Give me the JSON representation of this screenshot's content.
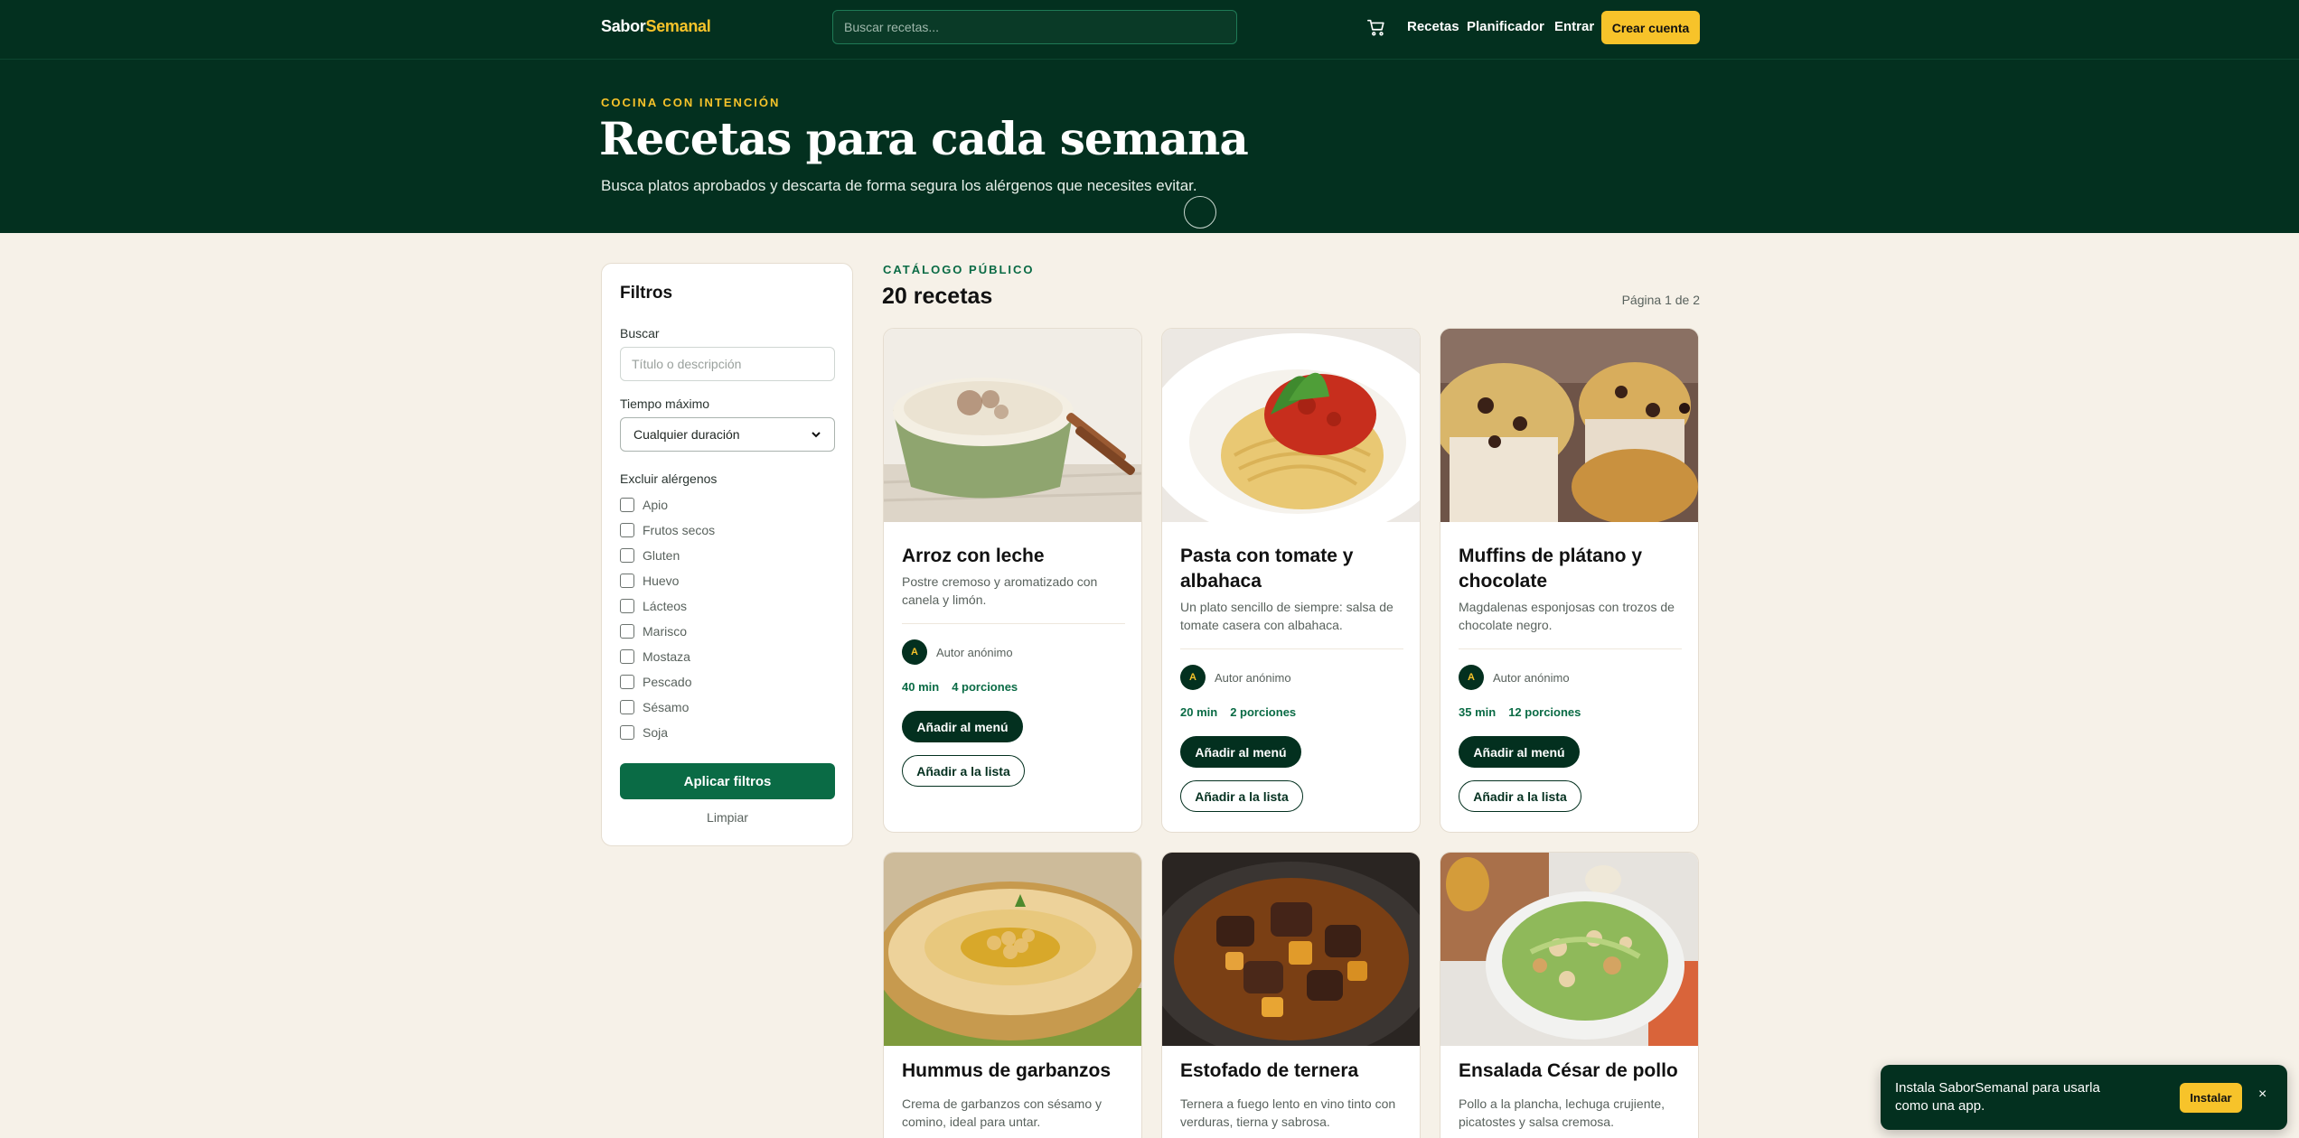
{
  "nav": {
    "logo_part1": "Sabor",
    "logo_part2": "Semanal",
    "search_placeholder": "Buscar recetas...",
    "links": [
      "Recetas",
      "Planificador",
      "Entrar"
    ],
    "create_account": "Crear cuenta"
  },
  "hero": {
    "eyebrow": "COCINA CON INTENCIÓN",
    "title": "Recetas para cada semana",
    "subtitle": "Busca platos aprobados y descarta de forma segura los alérgenos que necesites evitar."
  },
  "filters": {
    "title": "Filtros",
    "search_label": "Buscar",
    "search_placeholder": "Título o descripción",
    "time_label": "Tiempo máximo",
    "time_value": "Cualquier duración",
    "allergens_label": "Excluir alérgenos",
    "allergens": [
      "Apio",
      "Frutos secos",
      "Gluten",
      "Huevo",
      "Lácteos",
      "Marisco",
      "Mostaza",
      "Pescado",
      "Sésamo",
      "Soja"
    ],
    "apply": "Aplicar filtros",
    "clear": "Limpiar"
  },
  "catalog": {
    "eyebrow": "CATÁLOGO PÚBLICO",
    "title": "20 recetas",
    "page_indicator": "Página 1 de 2"
  },
  "card_labels": {
    "add_menu": "Añadir al menú",
    "add_list": "Añadir a la lista"
  },
  "recipes": [
    {
      "title": "Arroz con leche",
      "description": "Postre cremoso y aromatizado con canela y limón.",
      "author": "Autor anónimo",
      "avatar": "A",
      "time": "40 min",
      "servings": "4 porciones"
    },
    {
      "title": "Pasta con tomate y albahaca",
      "description": "Un plato sencillo de siempre: salsa de tomate casera con albahaca.",
      "author": "Autor anónimo",
      "avatar": "A",
      "time": "20 min",
      "servings": "2 porciones"
    },
    {
      "title": "Muffins de plátano y chocolate",
      "description": "Magdalenas esponjosas con trozos de chocolate negro.",
      "author": "Autor anónimo",
      "avatar": "A",
      "time": "35 min",
      "servings": "12 porciones"
    },
    {
      "title": "Hummus de garbanzos",
      "description": "Crema de garbanzos con sésamo y comino, ideal para untar."
    },
    {
      "title": "Estofado de ternera",
      "description": "Ternera a fuego lento en vino tinto con verduras, tierna y sabrosa."
    },
    {
      "title": "Ensalada César de pollo",
      "description": "Pollo a la plancha, lechuga crujiente, picatostes y salsa cremosa."
    }
  ],
  "toast": {
    "text": "Instala SaborSemanal para usarla como una app.",
    "install": "Instalar",
    "close": "×"
  },
  "colors": {
    "primary_dark": "#03301f",
    "accent_yellow": "#f7c32a",
    "green": "#0a6b45",
    "background": "#f6f1e8"
  }
}
